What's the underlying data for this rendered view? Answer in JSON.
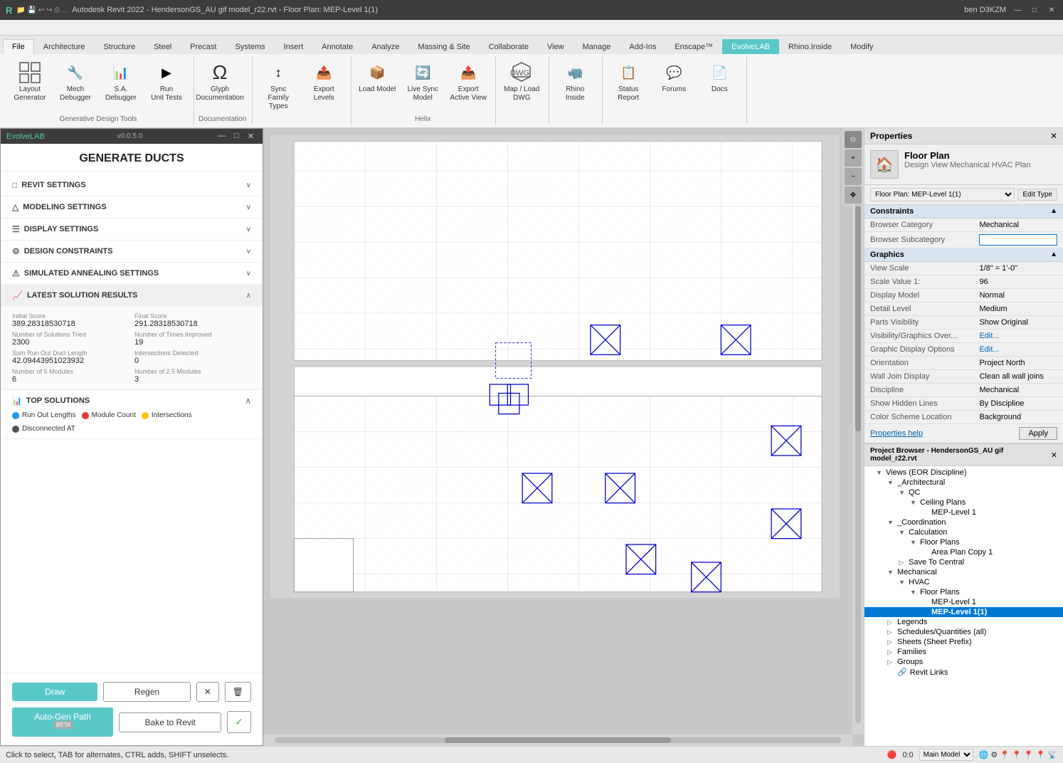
{
  "titleBar": {
    "title": "Autodesk Revit 2022 - HendersonGS_AU gif model_r22.rvt - Floor Plan: MEP-Level 1(1)",
    "appIcon": "R",
    "quickAccess": [
      "new",
      "open",
      "save",
      "undo",
      "redo",
      "print"
    ],
    "userInfo": "ben D3KZM",
    "minBtn": "—",
    "maxBtn": "□",
    "closeBtn": "✕"
  },
  "menuBar": {
    "items": [
      "File",
      "Architecture",
      "Structure",
      "Steel",
      "Precast",
      "Systems",
      "Insert",
      "Annotate",
      "Analyze",
      "Massing & Site",
      "Collaborate",
      "View",
      "Manage",
      "Add-Ins",
      "Enscape™",
      "EvolveLAB",
      "Rhino.Inside",
      "Modify"
    ]
  },
  "ribbon": {
    "groups": [
      {
        "id": "generative",
        "label": "Generative Design Tools",
        "buttons": [
          {
            "id": "layout-gen",
            "icon": "⊞",
            "label": "Layout\nGenerator"
          },
          {
            "id": "mech-debugger",
            "icon": "🔧",
            "label": "Mech\nDebugger"
          },
          {
            "id": "sa-debugger",
            "icon": "📊",
            "label": "S.A.\nDebugger"
          },
          {
            "id": "run-unit-tests",
            "icon": "▶",
            "label": "Run\nUnit Tests"
          }
        ]
      },
      {
        "id": "documentation",
        "label": "Documentation",
        "buttons": [
          {
            "id": "glyph",
            "icon": "Ω",
            "label": "Glyph\nDocumentation"
          }
        ]
      },
      {
        "id": "family-types",
        "label": "",
        "buttons": [
          {
            "id": "sync-family",
            "icon": "↕",
            "label": "Sync\nFamily Types"
          },
          {
            "id": "export-levels",
            "icon": "📤",
            "label": "Export\nLevels"
          }
        ]
      },
      {
        "id": "load-model",
        "label": "",
        "buttons": [
          {
            "id": "load-model",
            "icon": "📦",
            "label": "Load Model"
          },
          {
            "id": "live-sync",
            "icon": "🔄",
            "label": "Live Sync\nModel"
          },
          {
            "id": "export-active",
            "icon": "📤",
            "label": "Export\nActive View"
          }
        ]
      },
      {
        "id": "helix",
        "label": "Helix",
        "buttons": [
          {
            "id": "map-dwg",
            "icon": "🗺",
            "label": "Map / Load\nDWG"
          }
        ]
      },
      {
        "id": "rhino",
        "label": "",
        "buttons": [
          {
            "id": "rhino-inside",
            "icon": "🦏",
            "label": "Rhino\nInside"
          }
        ]
      },
      {
        "id": "status",
        "label": "",
        "buttons": [
          {
            "id": "status-report",
            "icon": "📋",
            "label": "Status\nReport"
          }
        ]
      },
      {
        "id": "community",
        "label": "",
        "buttons": [
          {
            "id": "forums",
            "icon": "💬",
            "label": "Forums"
          },
          {
            "id": "docs",
            "icon": "📄",
            "label": "Docs"
          }
        ]
      }
    ]
  },
  "leftPanel": {
    "appName": "EvolveLAB",
    "version": "v0.0.5.0",
    "title": "GENERATE DUCTS",
    "sections": [
      {
        "id": "revit-settings",
        "label": "REVIT SETTINGS",
        "icon": "□",
        "expanded": false
      },
      {
        "id": "modeling-settings",
        "label": "MODELING SETTINGS",
        "icon": "△",
        "expanded": false
      },
      {
        "id": "display-settings",
        "label": "DISPLAY SETTINGS",
        "icon": "☰",
        "expanded": false
      },
      {
        "id": "design-constraints",
        "label": "DESIGN CONSTRAINTS",
        "icon": "⚙",
        "expanded": false
      },
      {
        "id": "simulated-annealing",
        "label": "SIMULATED ANNEALING SETTINGS",
        "icon": "⚠",
        "expanded": false
      }
    ],
    "results": {
      "title": "LATEST SOLUTION RESULTS",
      "expanded": true,
      "items": [
        {
          "label": "Initial Score",
          "value": "389.28318530718"
        },
        {
          "label": "Final Score",
          "value": "291.28318530718"
        },
        {
          "label": "Number of Solutions Tried",
          "value": "2300"
        },
        {
          "label": "Number of Times Improved",
          "value": "19"
        },
        {
          "label": "Sum Run Out Duct Length",
          "value": "42.09443951023932"
        },
        {
          "label": "Intersections Detected",
          "value": "0"
        },
        {
          "label": "Number of 5 Modules",
          "value": "6"
        },
        {
          "label": "Number of 2.5 Modules",
          "value": "3"
        }
      ]
    },
    "topSolutions": {
      "title": "TOP SOLUTIONS",
      "legend": [
        {
          "label": "Run Out Lengths",
          "color": "#2196F3"
        },
        {
          "label": "Module Count",
          "color": "#e53935"
        },
        {
          "label": "Intersections",
          "color": "#FFC107"
        },
        {
          "label": "Disconnected AT",
          "color": "#555555"
        }
      ]
    },
    "footer": {
      "drawBtn": "Draw",
      "regenBtn": "Regen",
      "xBtn": "✕",
      "trashBtn": "🗑",
      "autoGenBtn": "Auto-Gen Path",
      "autogenBeta": "BETA",
      "bakeBtn": "Bake to Revit",
      "checkBtn": "✓"
    }
  },
  "canvas": {
    "bgColor": "#c8c8c8",
    "gridColor": "#ddd"
  },
  "properties": {
    "title": "Properties",
    "closeBtn": "✕",
    "viewType": "Floor Plan",
    "viewSubtype": "Design View Mechanical HVAC Plan",
    "floorPlanLabel": "Floor Plan: MEP-Level 1(1)",
    "editTypeBtn": "Edit Type",
    "sections": [
      {
        "title": "Constraints",
        "rows": [
          {
            "label": "Browser Category",
            "value": "Mechanical"
          },
          {
            "label": "Browser Subcategory",
            "value": ""
          }
        ]
      },
      {
        "title": "Graphics",
        "rows": [
          {
            "label": "View Scale",
            "value": "1/8\" = 1'-0\""
          },
          {
            "label": "Scale Value  1:",
            "value": "96"
          },
          {
            "label": "Display Model",
            "value": "Normal"
          },
          {
            "label": "Detail Level",
            "value": "Medium"
          },
          {
            "label": "Parts Visibility",
            "value": "Show Original"
          },
          {
            "label": "Visibility/Graphics Over...",
            "value": "Edit..."
          },
          {
            "label": "Graphic Display Options",
            "value": "Edit..."
          },
          {
            "label": "Orientation",
            "value": "Project North"
          },
          {
            "label": "Wall Join Display",
            "value": "Clean all wall joins"
          },
          {
            "label": "Discipline",
            "value": "Mechanical"
          },
          {
            "label": "Show Hidden Lines",
            "value": "By Discipline"
          },
          {
            "label": "Color Scheme Location",
            "value": "Background"
          }
        ]
      }
    ],
    "propertiesHelp": "Properties help",
    "applyBtn": "Apply"
  },
  "projectBrowser": {
    "title": "Project Browser - HendersonGS_AU gif model_r22.rvt",
    "closeBtn": "✕",
    "tree": [
      {
        "level": 0,
        "expand": "▼",
        "icon": "📁",
        "label": "Views (EOR Discipline)",
        "selected": false
      },
      {
        "level": 1,
        "expand": "▼",
        "icon": "📁",
        "label": "_Architectural",
        "selected": false
      },
      {
        "level": 2,
        "expand": "▼",
        "icon": "📁",
        "label": "QC",
        "selected": false
      },
      {
        "level": 3,
        "expand": "▼",
        "icon": "📁",
        "label": "Ceiling Plans",
        "selected": false
      },
      {
        "level": 4,
        "expand": "",
        "icon": "📄",
        "label": "MEP-Level 1",
        "selected": false
      },
      {
        "level": 1,
        "expand": "▼",
        "icon": "📁",
        "label": "_Coordination",
        "selected": false
      },
      {
        "level": 2,
        "expand": "▼",
        "icon": "📁",
        "label": "Calculation",
        "selected": false
      },
      {
        "level": 3,
        "expand": "▼",
        "icon": "📁",
        "label": "Floor Plans",
        "selected": false
      },
      {
        "level": 4,
        "expand": "",
        "icon": "📄",
        "label": "Area Plan Copy 1",
        "selected": false
      },
      {
        "level": 2,
        "expand": "▷",
        "icon": "📁",
        "label": "Save To Central",
        "selected": false
      },
      {
        "level": 1,
        "expand": "▼",
        "icon": "📁",
        "label": "Mechanical",
        "selected": false
      },
      {
        "level": 2,
        "expand": "▼",
        "icon": "📁",
        "label": "HVAC",
        "selected": false
      },
      {
        "level": 3,
        "expand": "▼",
        "icon": "📁",
        "label": "Floor Plans",
        "selected": false
      },
      {
        "level": 4,
        "expand": "",
        "icon": "📄",
        "label": "MEP-Level 1",
        "selected": false
      },
      {
        "level": 4,
        "expand": "",
        "icon": "📄",
        "label": "MEP-Level 1(1)",
        "selected": true,
        "bold": true
      },
      {
        "level": 1,
        "expand": "▷",
        "icon": "📁",
        "label": "Legends",
        "selected": false
      },
      {
        "level": 1,
        "expand": "▷",
        "icon": "📁",
        "label": "Schedules/Quantities (all)",
        "selected": false
      },
      {
        "level": 1,
        "expand": "▷",
        "icon": "📁",
        "label": "Sheets (Sheet Prefix)",
        "selected": false
      },
      {
        "level": 1,
        "expand": "▷",
        "icon": "📁",
        "label": "Families",
        "selected": false
      },
      {
        "level": 1,
        "expand": "▷",
        "icon": "📁",
        "label": "Groups",
        "selected": false
      },
      {
        "level": 1,
        "expand": "",
        "icon": "🔗",
        "label": "Revit Links",
        "selected": false
      }
    ]
  },
  "statusBar": {
    "text": "Click to select, TAB for alternates, CTRL adds, SHIFT unselects.",
    "coords": "0:0",
    "model": "Main Model"
  }
}
